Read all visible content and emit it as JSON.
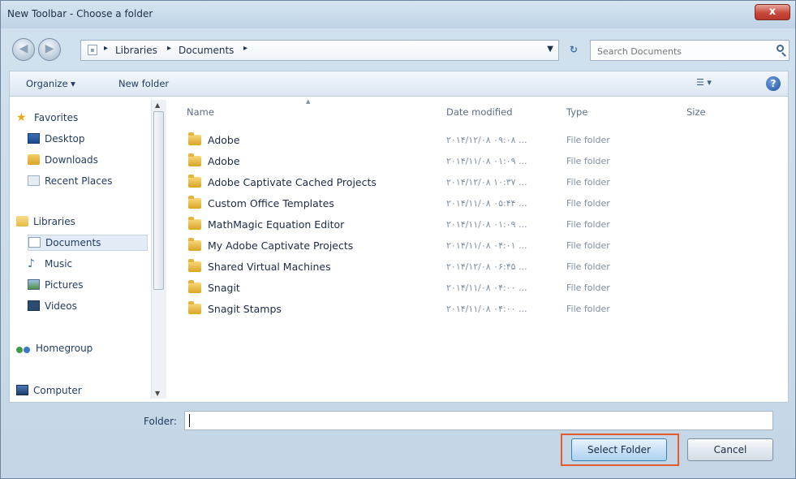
{
  "window": {
    "title": "New Toolbar - Choose a folder",
    "close_label": "x"
  },
  "nav": {
    "back_label": "◀",
    "forward_label": "▶",
    "breadcrumbs": [
      "Libraries",
      "Documents"
    ],
    "refresh_label": "↻",
    "search_placeholder": "Search Documents"
  },
  "toolbar": {
    "organize_label": "Organize ▾",
    "new_folder_label": "New folder",
    "views_label": "☰ ▾",
    "help_label": "?"
  },
  "sidebar": {
    "favorites": "Favorites",
    "desktop": "Desktop",
    "downloads": "Downloads",
    "recent_places": "Recent Places",
    "libraries": "Libraries",
    "documents": "Documents",
    "music": "Music",
    "pictures": "Pictures",
    "videos": "Videos",
    "homegroup": "Homegroup",
    "computer": "Computer"
  },
  "columns": {
    "name": "Name",
    "date_modified": "Date modified",
    "type": "Type",
    "size": "Size"
  },
  "files": [
    {
      "name": "Adobe",
      "date": "۲۰۱۴/۱۲/۰۸ ۰۹:۰۸ ...",
      "type": "File folder"
    },
    {
      "name": "Adobe",
      "date": "۲۰۱۴/۱۱/۰۸ ۰۱:۰۹ ...",
      "type": "File folder"
    },
    {
      "name": "Adobe Captivate Cached Projects",
      "date": "۲۰۱۴/۱۲/۰۸ ۱۰:۳۷ ...",
      "type": "File folder"
    },
    {
      "name": "Custom Office Templates",
      "date": "۲۰۱۴/۱۱/۰۸ ۰۵:۴۴ ...",
      "type": "File folder"
    },
    {
      "name": "MathMagic Equation Editor",
      "date": "۲۰۱۴/۱۱/۰۸ ۰۱:۰۹ ...",
      "type": "File folder"
    },
    {
      "name": "My Adobe Captivate Projects",
      "date": "۲۰۱۴/۱۱/۰۸ ۰۴:۰۱ ...",
      "type": "File folder"
    },
    {
      "name": "Shared Virtual Machines",
      "date": "۲۰۱۴/۱۲/۰۸ ۰۶:۴۵ ...",
      "type": "File folder"
    },
    {
      "name": "Snagit",
      "date": "۲۰۱۴/۱۱/۰۸ ۰۴:۰۰ ...",
      "type": "File folder"
    },
    {
      "name": "Snagit Stamps",
      "date": "۲۰۱۴/۱۱/۰۸ ۰۴:۰۰ ...",
      "type": "File folder"
    }
  ],
  "footer": {
    "folder_label": "Folder:",
    "folder_value": "",
    "select_label": "Select Folder",
    "cancel_label": "Cancel"
  }
}
